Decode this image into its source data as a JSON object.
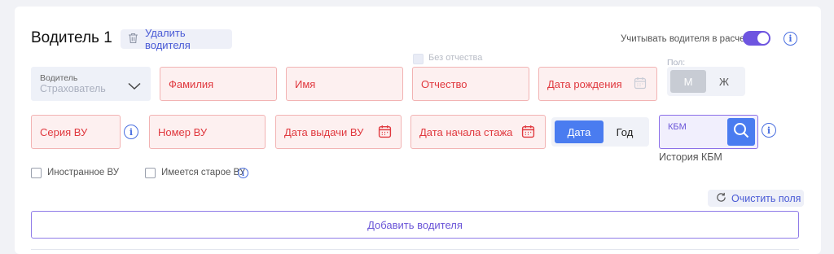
{
  "header": {
    "title": "Водитель 1",
    "delete_label": "Удалить водителя",
    "consider_label": "Учитывать водителя в расчете",
    "consider_on": true
  },
  "row1": {
    "driver_label": "Водитель",
    "driver_value": "Страхователь",
    "last_name": "Фамилия",
    "first_name": "Имя",
    "no_patronymic_label": "Без отчества",
    "patronymic": "Отчество",
    "birth_date": "Дата рождения",
    "gender_label": "Пол:",
    "gender_m": "М",
    "gender_f": "Ж"
  },
  "row2": {
    "license_series": "Серия ВУ",
    "license_number": "Номер ВУ",
    "issue_date": "Дата выдачи ВУ",
    "experience_start": "Дата начала стажа",
    "mode_date": "Дата",
    "mode_year": "Год",
    "kbm_label": "КБМ",
    "kbm_history": "История КБМ"
  },
  "row3": {
    "foreign_license": "Иностранное ВУ",
    "old_license": "Имеется старое ВУ"
  },
  "actions": {
    "clear": "Очистить поля",
    "add_driver": "Добавить водителя"
  },
  "colors": {
    "accent": "#6e55e0",
    "primary_blue": "#4a6fe0",
    "error_red": "#e0383e"
  }
}
